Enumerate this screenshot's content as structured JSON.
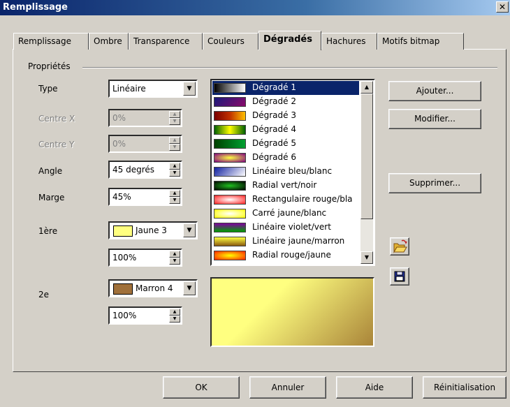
{
  "window": {
    "title": "Remplissage",
    "close": "✕"
  },
  "tabs": [
    "Remplissage",
    "Ombre",
    "Transparence",
    "Couleurs",
    "Dégradés",
    "Hachures",
    "Motifs bitmap"
  ],
  "group": "Propriétés",
  "fields": {
    "type": {
      "label": "Type",
      "value": "Linéaire"
    },
    "centre_x": {
      "label": "Centre X",
      "value": "0%"
    },
    "centre_y": {
      "label": "Centre Y",
      "value": "0%"
    },
    "angle": {
      "label": "Angle",
      "value": "45 degrés"
    },
    "marge": {
      "label": "Marge",
      "value": "45%"
    },
    "premiere": {
      "label": "1ère",
      "color_name": "Jaune 3",
      "color": "#ffff80",
      "intensity": "100%"
    },
    "deuxieme": {
      "label": "2e",
      "color_name": "Marron 4",
      "color": "#a0703a",
      "intensity": "100%"
    }
  },
  "gradients": [
    {
      "name": "Dégradé 1",
      "css": "linear-gradient(to right,#000,#fff)"
    },
    {
      "name": "Dégradé 2",
      "css": "linear-gradient(135deg,#1a1a7a,#8a0a6a)"
    },
    {
      "name": "Dégradé 3",
      "css": "linear-gradient(to right,#7a0000,#c03000,#ffc000)"
    },
    {
      "name": "Dégradé 4",
      "css": "linear-gradient(to right,#006000,#ffff00,#006000)"
    },
    {
      "name": "Dégradé 5",
      "css": "linear-gradient(to right,#004000,#00a030)"
    },
    {
      "name": "Dégradé 6",
      "css": "radial-gradient(#ffff40,#800080)"
    },
    {
      "name": "Linéaire bleu/blanc",
      "css": "linear-gradient(135deg,#1020a0,#ffffff)"
    },
    {
      "name": "Radial vert/noir",
      "css": "radial-gradient(#20c020,#000000)"
    },
    {
      "name": "Rectangulaire rouge/bla",
      "css": "radial-gradient(#ffffff,#ff2020)"
    },
    {
      "name": "Carré jaune/blanc",
      "css": "radial-gradient(#ffffff,#ffff00)"
    },
    {
      "name": "Linéaire violet/vert",
      "css": "linear-gradient(to bottom,#8000a0,#00a000)"
    },
    {
      "name": "Linéaire jaune/marron",
      "css": "linear-gradient(to bottom,#ffff40,#8a5a10)"
    },
    {
      "name": "Radial rouge/jaune",
      "css": "radial-gradient(#ffff00,#ff2000)"
    }
  ],
  "buttons": {
    "ajouter": "Ajouter...",
    "modifier": "Modifier...",
    "supprimer": "Supprimer...",
    "ok": "OK",
    "annuler": "Annuler",
    "aide": "Aide",
    "reinit": "Réinitialisation"
  },
  "icons": {
    "open": "open-folder-icon",
    "save": "save-disk-icon"
  }
}
